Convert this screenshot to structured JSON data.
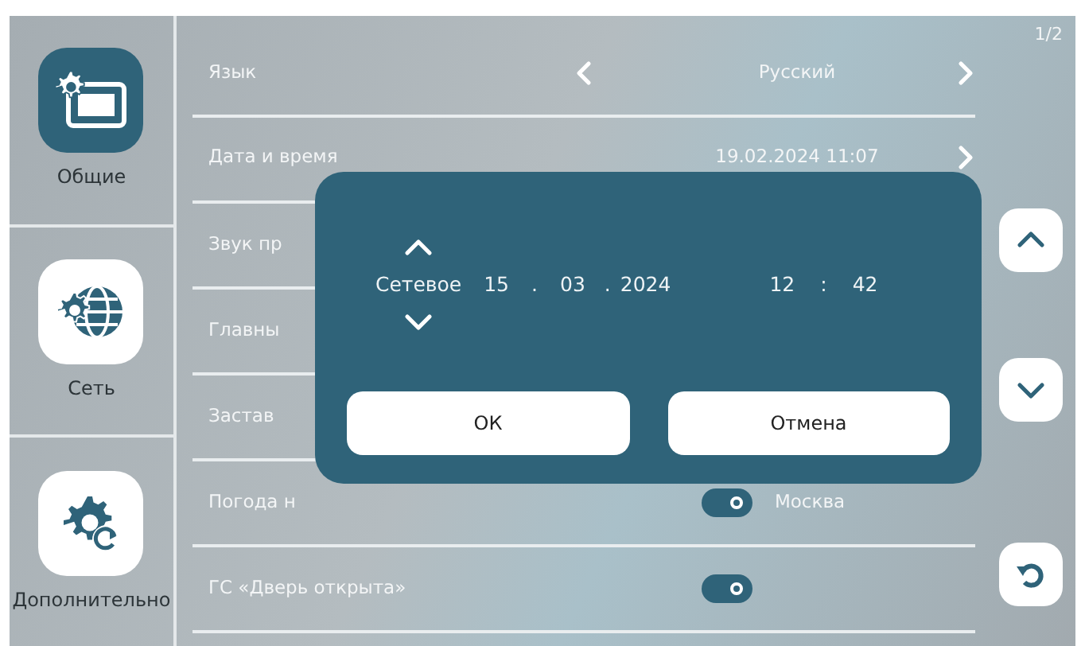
{
  "sidebar": {
    "items": [
      {
        "label": "Общие",
        "kind": "general",
        "selected": true
      },
      {
        "label": "Сеть",
        "kind": "network",
        "selected": false
      },
      {
        "label": "Дополнительно",
        "kind": "advanced",
        "selected": false
      }
    ]
  },
  "settings": {
    "rows": [
      {
        "kind": "select",
        "label": "Язык",
        "value": "Русский"
      },
      {
        "kind": "link",
        "label": "Дата и время",
        "value": "19.02.2024 11:07"
      },
      {
        "kind": "plain",
        "label": "Звук пр"
      },
      {
        "kind": "plain",
        "label": "Главны"
      },
      {
        "kind": "plain",
        "label": "Застав"
      },
      {
        "kind": "toggle",
        "label": "Погода н",
        "on": true,
        "value": "Москва"
      },
      {
        "kind": "toggle",
        "label": "ГС «Дверь открыта»",
        "on": true
      }
    ]
  },
  "page_indicator": "1/2",
  "dialog": {
    "mode": "Сетевое",
    "date_separator": ".",
    "time_separator": ":",
    "day": "15",
    "month": "03",
    "year": "2024",
    "hour": "12",
    "minute": "42",
    "buttons": [
      "ОК",
      "Отмена"
    ]
  }
}
